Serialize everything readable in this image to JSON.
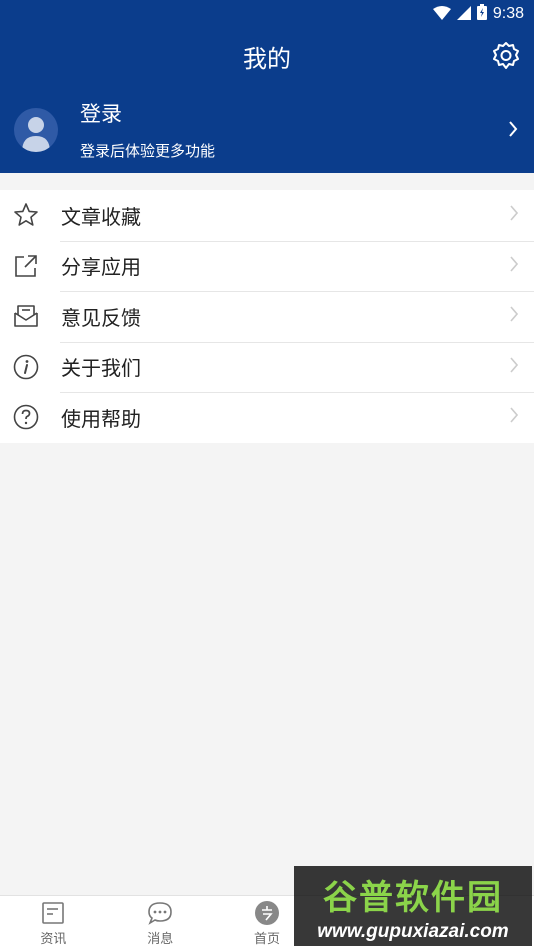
{
  "status_bar": {
    "time": "9:38"
  },
  "header": {
    "title": "我的"
  },
  "profile": {
    "login": "登录",
    "subtitle": "登录后体验更多功能"
  },
  "menu": [
    {
      "label": "文章收藏",
      "icon": "star-icon"
    },
    {
      "label": "分享应用",
      "icon": "share-icon"
    },
    {
      "label": "意见反馈",
      "icon": "feedback-envelope-icon"
    },
    {
      "label": "关于我们",
      "icon": "info-icon"
    },
    {
      "label": "使用帮助",
      "icon": "help-icon"
    }
  ],
  "tabbar": [
    {
      "label": "资讯",
      "icon": "news-icon"
    },
    {
      "label": "消息",
      "icon": "chat-icon"
    },
    {
      "label": "首页",
      "icon": "home-icon"
    },
    {
      "label": "",
      "icon": "tab-icon"
    },
    {
      "label": "",
      "icon": "me-icon"
    }
  ],
  "watermark": {
    "main": "谷普软件园",
    "url": "www.gupuxiazai.com"
  },
  "colors": {
    "header_bg": "#0b3d8c",
    "page_bg": "#f4f4f4",
    "watermark_green": "#8bd44a"
  }
}
